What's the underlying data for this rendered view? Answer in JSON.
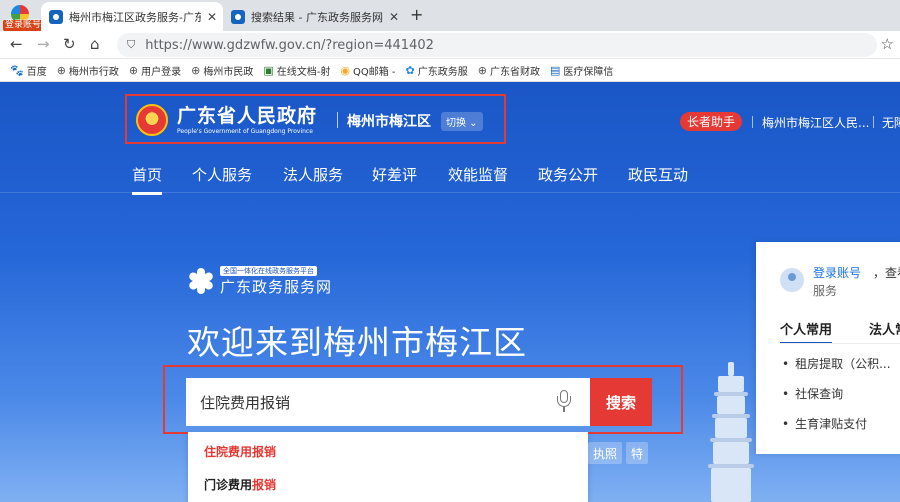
{
  "browser": {
    "profile_label": "登录账号",
    "tabs": [
      {
        "title": "梅州市梅江区政务服务-广东政",
        "close": "✕"
      },
      {
        "title": "搜索结果 - 广东政务服务网",
        "close": "✕"
      }
    ],
    "new_tab": "+",
    "url": "https://www.gdzwfw.gov.cn/?region=441402",
    "bookmarks": [
      {
        "icon": "🐾",
        "label": "百度"
      },
      {
        "icon": "⊕",
        "label": "梅州市行政"
      },
      {
        "icon": "⊕",
        "label": "用户登录"
      },
      {
        "icon": "⊕",
        "label": "梅州市民政"
      },
      {
        "icon": "▣",
        "label": "在线文档-射"
      },
      {
        "icon": "◉",
        "label": "QQ邮箱 -"
      },
      {
        "icon": "✿",
        "label": "广东政务服"
      },
      {
        "icon": "⊕",
        "label": "广东省财政"
      },
      {
        "icon": "▤",
        "label": "医疗保障信"
      }
    ]
  },
  "header": {
    "gov_title": "广东省人民政府",
    "gov_subtitle": "People's Government of Guangdong Province",
    "city": "梅州市梅江区",
    "switch_label": "切换 ⌄",
    "elder_button": "长者助手",
    "links": [
      "梅州市梅江区人民...",
      "无障"
    ]
  },
  "nav": {
    "items": [
      "首页",
      "个人服务",
      "法人服务",
      "好差评",
      "效能监督",
      "政务公开",
      "政民互动"
    ]
  },
  "hero": {
    "platform_tag": "全国一体化在线政务服务平台",
    "platform_name": "广东政务服务网",
    "welcome": "欢迎来到梅州市梅江区",
    "search_value": "住院费用报销",
    "search_button": "搜索",
    "suggestions": [
      {
        "plain": "住院费用",
        "highlight": "报销"
      },
      {
        "plain": "门诊费用",
        "highlight": "报销"
      }
    ],
    "quick_tags": [
      "执照",
      "特"
    ]
  },
  "panel": {
    "login_link": "登录账号",
    "login_rest": "，查看",
    "login_tail": "服务",
    "tabs": [
      "个人常用",
      "法人常"
    ],
    "items": [
      "租房提取（公积...",
      "社保查询",
      "生育津贴支付"
    ]
  },
  "colors": {
    "brand_blue": "#1a56c6",
    "accent_red": "#e53935"
  }
}
